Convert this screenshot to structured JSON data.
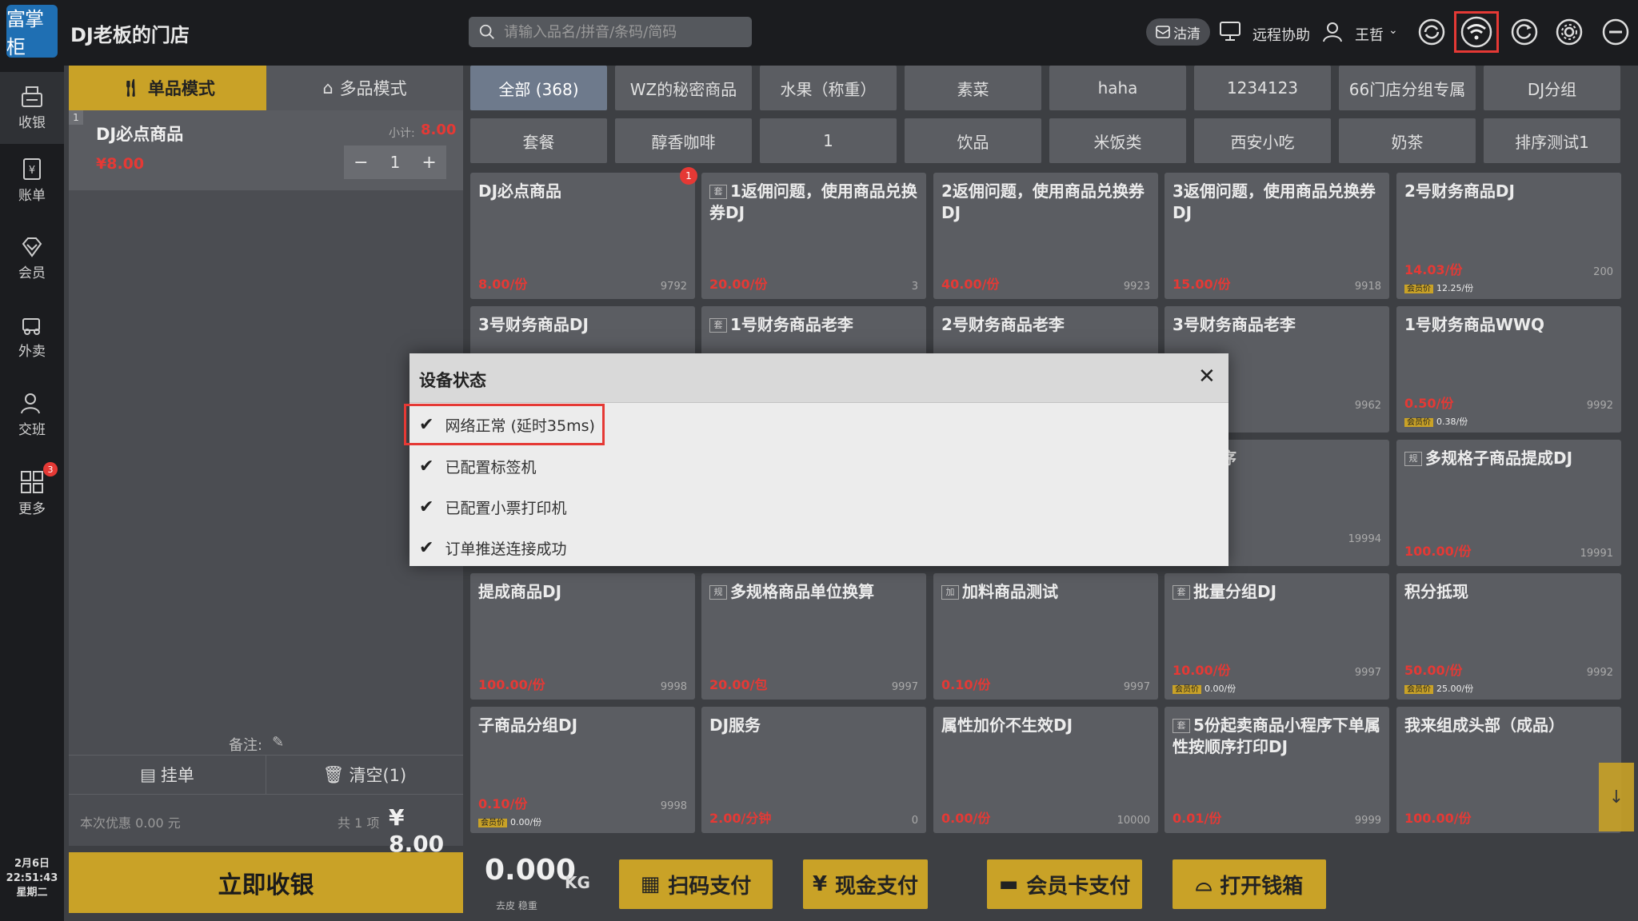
{
  "header": {
    "logo_text": "富掌柜",
    "store_name": "DJ老板的门店",
    "search_placeholder": "请输入品名/拼音/条码/简码",
    "chip_label": "沽清",
    "remote_help": "远程协助",
    "user_name": "王哲"
  },
  "sidebar": {
    "items": [
      {
        "label": "收银",
        "icon": "cashier-icon"
      },
      {
        "label": "账单",
        "icon": "bill-icon"
      },
      {
        "label": "会员",
        "icon": "member-icon"
      },
      {
        "label": "外卖",
        "icon": "delivery-icon"
      },
      {
        "label": "交班",
        "icon": "shift-icon"
      },
      {
        "label": "更多",
        "icon": "more-icon",
        "badge": "3"
      }
    ],
    "date": "2月6日",
    "time": "22:51:43",
    "weekday": "星期二"
  },
  "order": {
    "mode_single": "单品模式",
    "mode_multi": "多品模式",
    "item": {
      "index": "1",
      "name": "DJ必点商品",
      "subtotal_label": "小计:",
      "subtotal": "8.00",
      "price": "¥8.00",
      "qty": "1"
    },
    "remark_label": "备注:",
    "hold_label": "挂单",
    "clear_label": "清空(1)",
    "discount": "本次优惠 0.00 元",
    "count": "共 1 项",
    "total": "¥ 8.00",
    "checkout": "立即收银"
  },
  "categories": [
    "全部 (368)",
    "WZ的秘密商品",
    "水果（称重）",
    "素菜",
    "haha",
    "1234123",
    "66门店分组专属",
    "DJ分组",
    "套餐",
    "醇香咖啡",
    "1",
    "饮品",
    "米饭类",
    "西安小吃",
    "奶茶",
    "排序测试1"
  ],
  "products": [
    {
      "name": "DJ必点商品",
      "price": "8.00/份",
      "stock": "9792",
      "tag": "",
      "badge": "1"
    },
    {
      "name": "1返佣问题，使用商品兑换券DJ",
      "price": "20.00/份",
      "stock": "3",
      "tag": "套"
    },
    {
      "name": "2返佣问题，使用商品兑换券DJ",
      "price": "40.00/份",
      "stock": "9923",
      "tag": ""
    },
    {
      "name": "3返佣问题，使用商品兑换券DJ",
      "price": "15.00/份",
      "stock": "9918",
      "tag": ""
    },
    {
      "name": "2号财务商品DJ",
      "price": "14.03/份",
      "stock": "200",
      "tag": "",
      "member": "12.25/份"
    },
    {
      "name": "3号财务商品DJ",
      "price": "",
      "stock": "",
      "tag": ""
    },
    {
      "name": "1号财务商品老李",
      "price": "",
      "stock": "",
      "tag": "套"
    },
    {
      "name": "2号财务商品老李",
      "price": "",
      "stock": "",
      "tag": ""
    },
    {
      "name": "3号财务商品老李",
      "price": "",
      "stock": "9962",
      "tag": "",
      "member": "/份"
    },
    {
      "name": "1号财务商品WWQ",
      "price": "0.50/份",
      "stock": "9992",
      "tag": "",
      "member": "0.38/份"
    },
    {
      "name": "",
      "price": "",
      "stock": "",
      "tag": ""
    },
    {
      "name": "",
      "price": "",
      "stock": "",
      "tag": ""
    },
    {
      "name": "",
      "price": "",
      "stock": "",
      "tag": ""
    },
    {
      "name": "规格排序",
      "price": "",
      "stock": "19994",
      "tag": "",
      "member": "份"
    },
    {
      "name": "多规格子商品提成DJ",
      "price": "100.00/份",
      "stock": "19991",
      "tag": "规"
    },
    {
      "name": "提成商品DJ",
      "price": "100.00/份",
      "stock": "9998",
      "tag": ""
    },
    {
      "name": "多规格商品单位换算",
      "price": "20.00/包",
      "stock": "9997",
      "tag": "规"
    },
    {
      "name": "加料商品测试",
      "price": "0.10/份",
      "stock": "9997",
      "tag": "加"
    },
    {
      "name": "批量分组DJ",
      "price": "10.00/份",
      "stock": "9997",
      "tag": "套",
      "member": "0.00/份"
    },
    {
      "name": "积分抵现",
      "price": "50.00/份",
      "stock": "9992",
      "tag": "",
      "member": "25.00/份"
    },
    {
      "name": "子商品分组DJ",
      "price": "0.10/份",
      "stock": "9998",
      "tag": "",
      "member": "0.00/份"
    },
    {
      "name": "DJ服务",
      "price": "2.00/分钟",
      "stock": "0",
      "tag": ""
    },
    {
      "name": "属性加价不生效DJ",
      "price": "0.00/份",
      "stock": "10000",
      "tag": ""
    },
    {
      "name": "5份起卖商品小程序下单属性按顺序打印DJ",
      "price": "0.01/份",
      "stock": "9999",
      "tag": "套"
    },
    {
      "name": "我来组成头部（成品）",
      "price": "100.00/份",
      "stock": "",
      "tag": ""
    }
  ],
  "member_tag": "会员价",
  "bottom": {
    "weight": "0.000",
    "unit": "KG",
    "weight_labels": "去皮 稳重",
    "scan_pay": "扫码支付",
    "cash_pay": "现金支付",
    "card_pay": "会员卡支付",
    "open_drawer": "打开钱箱"
  },
  "dialog": {
    "title": "设备状态",
    "close": "✕",
    "rows": [
      "网络正常 (延时35ms)",
      "已配置标签机",
      "已配置小票打印机",
      "订单推送连接成功"
    ]
  },
  "colors": {
    "accent": "#c9a227",
    "price_red": "#e53935",
    "highlight": "#e53935"
  }
}
